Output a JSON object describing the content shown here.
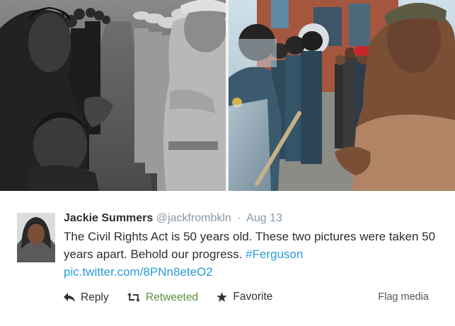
{
  "tweet": {
    "fullname": "Jackie Summers",
    "username": "@jackfrombkln",
    "separator": "·",
    "timestamp": "Aug 13",
    "text": "The Civil Rights Act is 50 years old. These two pictures were taken 50 years apart. Behold our progress.",
    "hashtag": "#Ferguson",
    "pic_link": "pic.twitter.com/8PNn8eteO2"
  },
  "actions": {
    "reply": "Reply",
    "retweet": "Retweeted",
    "favorite": "Favorite",
    "flag_media": "Flag media"
  },
  "colors": {
    "link": "#2a9bd7",
    "retweeted": "#5c913b",
    "name": "#292f33",
    "meta": "#8899a6"
  },
  "icons": {
    "reply": "reply-arrow-icon",
    "retweet": "retweet-icon",
    "favorite": "star-icon"
  }
}
